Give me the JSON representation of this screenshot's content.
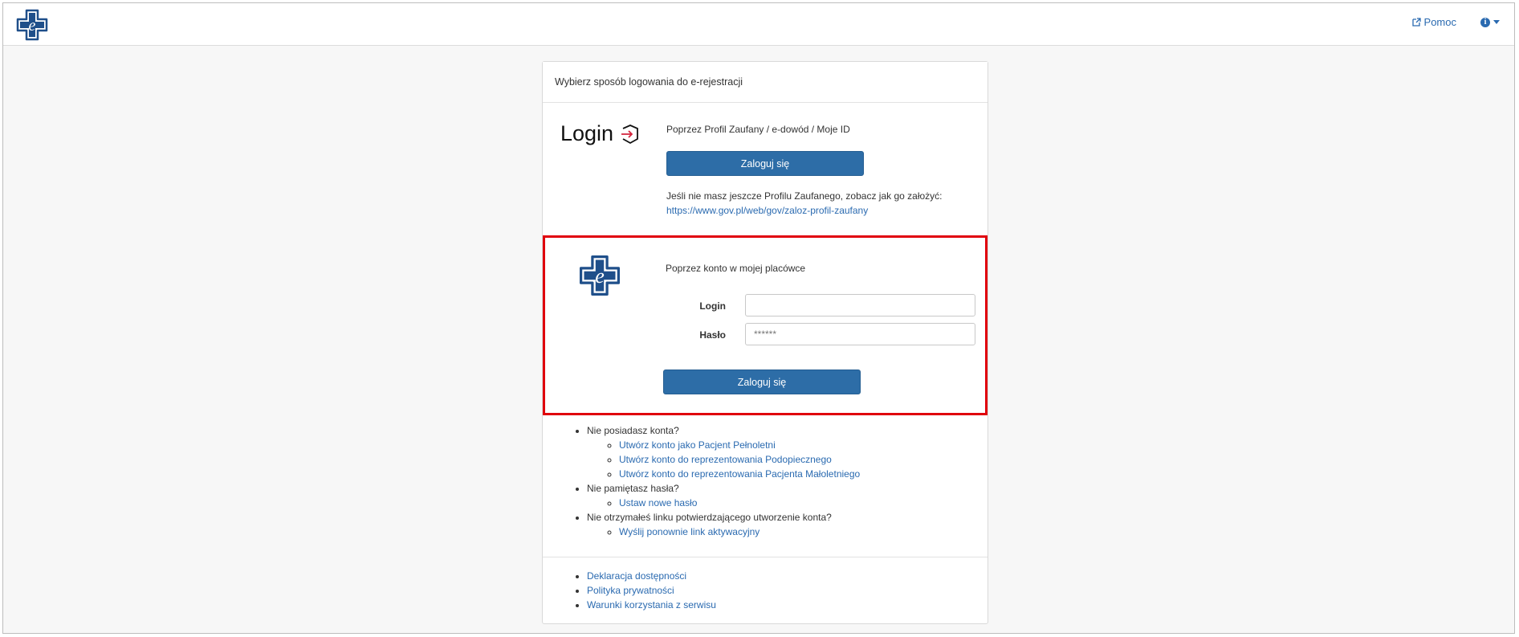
{
  "header": {
    "help_label": "Pomoc",
    "logo_letter": "e"
  },
  "panel": {
    "title": "Wybierz sposób logowania do e-rejestracji",
    "profile": {
      "logo_text": "Login",
      "title": "Poprzez Profil Zaufany / e-dowód / Moje ID",
      "button": "Zaloguj się",
      "info": "Jeśli nie masz jeszcze Profilu Zaufanego, zobacz jak go założyć:",
      "link": "https://www.gov.pl/web/gov/zaloz-profil-zaufany"
    },
    "account": {
      "logo_letter": "e",
      "title": "Poprzez konto w mojej placówce",
      "login_label": "Login",
      "login_value": "",
      "password_label": "Hasło",
      "password_value": "******",
      "button": "Zaloguj się"
    }
  },
  "links": {
    "q1": "Nie posiadasz konta?",
    "q1_items": [
      "Utwórz konto jako Pacjent Pełnoletni",
      "Utwórz konto do reprezentowania Podopiecznego",
      "Utwórz konto do reprezentowania Pacjenta Małoletniego"
    ],
    "q2": "Nie pamiętasz hasła?",
    "q2_items": [
      "Ustaw nowe hasło"
    ],
    "q3": "Nie otrzymałeś linku potwierdzającego utworzenie konta?",
    "q3_items": [
      "Wyślij ponownie link aktywacyjny"
    ]
  },
  "footer": [
    "Deklaracja dostępności",
    "Polityka prywatności",
    "Warunki korzystania z serwisu"
  ],
  "colors": {
    "primary": "#2d6da7",
    "highlight": "#e0000c",
    "link": "#2a6ab0"
  }
}
